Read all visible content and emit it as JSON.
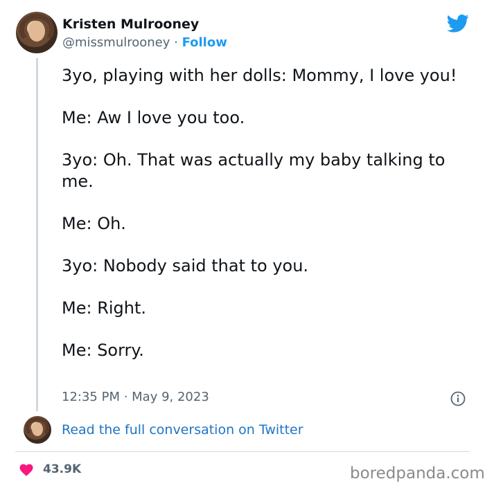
{
  "author": {
    "name": "Kristen Mulrooney",
    "handle": "@missmulrooney",
    "separator": " · ",
    "follow_label": "Follow"
  },
  "tweet": {
    "lines": [
      "3yo, playing with her dolls: Mommy, I love you!",
      "Me: Aw I love you too.",
      "3yo: Oh. That was actually my baby talking to me.",
      "Me: Oh.",
      "3yo: Nobody said that to you.",
      "Me: Right.",
      "Me: Sorry."
    ],
    "timestamp": "12:35 PM · May 9, 2023"
  },
  "read_full_label": "Read the full conversation on Twitter",
  "likes": "43.9K",
  "watermark": "boredpanda.com",
  "colors": {
    "twitter_blue": "#1d9bf0",
    "heart": "#f91880",
    "text": "#0f1419",
    "muted": "#536471"
  },
  "icons": {
    "brand": "twitter-bird-icon",
    "info": "info-icon",
    "like": "heart-icon"
  }
}
